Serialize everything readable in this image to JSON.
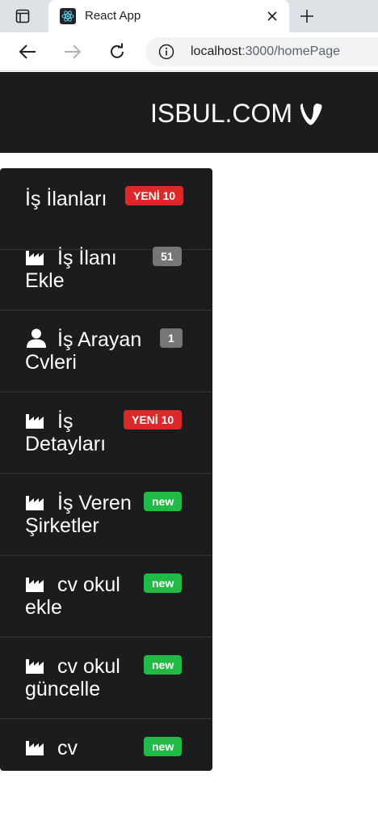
{
  "browser": {
    "tab_title": "React App",
    "url_host": "localhost",
    "url_path": ":3000/homePage"
  },
  "header": {
    "brand": "ISBUL.COM",
    "brand_logo": "typo3-icon"
  },
  "menu": {
    "items": [
      {
        "label": "İş İlanları",
        "icon": "",
        "badge": "YENİ 10",
        "badge_color": "#db2828"
      },
      {
        "label": "İş İlanı Ekle",
        "icon": "factory-icon",
        "badge": "51",
        "badge_color": "#767676"
      },
      {
        "label": "İş Arayan Cvleri",
        "icon": "user-icon",
        "badge": "1",
        "badge_color": "#767676"
      },
      {
        "label": "İş Detayları",
        "icon": "factory-icon",
        "badge": "YENİ 10",
        "badge_color": "#db2828"
      },
      {
        "label": "İş Veren Şirketler",
        "icon": "factory-icon",
        "badge": "new",
        "badge_color": "#21ba45"
      },
      {
        "label": "cv okul ekle",
        "icon": "factory-icon",
        "badge": "new",
        "badge_color": "#21ba45"
      },
      {
        "label": "cv okul güncelle",
        "icon": "factory-icon",
        "badge": "new",
        "badge_color": "#21ba45"
      },
      {
        "label": "cv",
        "icon": "factory-icon",
        "badge": "new",
        "badge_color": "#21ba45"
      }
    ]
  }
}
